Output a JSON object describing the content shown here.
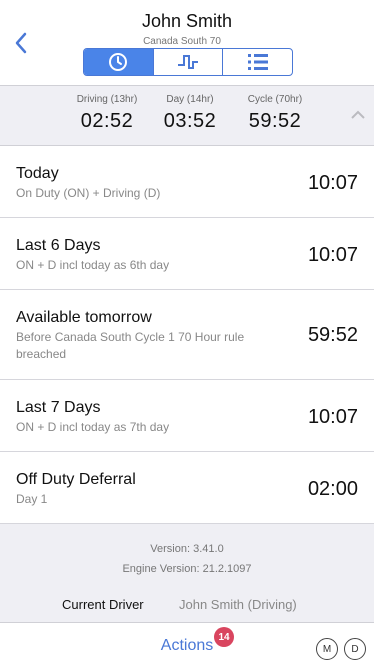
{
  "header": {
    "title": "John Smith",
    "subtitle": "Canada South 70",
    "tabs": [
      {
        "icon": "clock-icon",
        "active": true
      },
      {
        "icon": "graph-icon",
        "active": false
      },
      {
        "icon": "list-icon",
        "active": false
      }
    ]
  },
  "summary": {
    "driving_label": "Driving (13hr)",
    "driving_value": "02:52",
    "day_label": "Day (14hr)",
    "day_value": "03:52",
    "cycle_label": "Cycle (70hr)",
    "cycle_value": "59:52"
  },
  "rows": [
    {
      "title": "Today",
      "subtitle": "On Duty (ON) + Driving (D)",
      "value": "10:07"
    },
    {
      "title": "Last 6 Days",
      "subtitle": "ON + D incl today as 6th day",
      "value": "10:07"
    },
    {
      "title": "Available tomorrow",
      "subtitle": "Before Canada South Cycle 1 70 Hour rule breached",
      "value": "59:52"
    },
    {
      "title": "Last 7 Days",
      "subtitle": "ON + D incl today as 7th day",
      "value": "10:07"
    },
    {
      "title": "Off Duty Deferral",
      "subtitle": "Day 1",
      "value": "02:00"
    }
  ],
  "info": {
    "version": "Version: 3.41.0",
    "engine_version": "Engine Version: 21.2.1097",
    "current_driver_label": "Current Driver",
    "current_driver_value": "John Smith (Driving)"
  },
  "bottom": {
    "actions_label": "Actions",
    "badge_count": "14",
    "m_label": "M",
    "d_label": "D"
  },
  "colors": {
    "accent": "#4a84e8",
    "badge": "#d9455f"
  }
}
